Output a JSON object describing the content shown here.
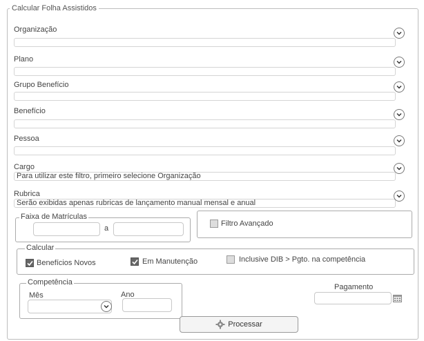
{
  "form": {
    "title": "Calcular Folha Assistidos",
    "fields": [
      {
        "label": "Organização",
        "value": ""
      },
      {
        "label": "Plano",
        "value": ""
      },
      {
        "label": "Grupo Benefício",
        "value": ""
      },
      {
        "label": "Benefício",
        "value": ""
      },
      {
        "label": "Pessoa",
        "value": ""
      },
      {
        "label": "Cargo",
        "value": "Para utilizar este filtro, primeiro selecione Organização"
      },
      {
        "label": "Rubrica",
        "value": "Serão exibidas apenas rubricas de lançamento manual mensal e anual"
      }
    ]
  },
  "faixa": {
    "title": "Faixa de Matrículas",
    "separator": "a"
  },
  "filtro": {
    "label": "Filtro Avançado",
    "checked": false
  },
  "calcular": {
    "title": "Calcular",
    "options": [
      {
        "label": "Benefícios Novos",
        "checked": true
      },
      {
        "label": "Em Manutenção",
        "checked": true
      },
      {
        "label": "Inclusive DIB > Pgto. na competência",
        "checked": false
      }
    ]
  },
  "competencia": {
    "title": "Competência",
    "mes_label": "Mês",
    "ano_label": "Ano"
  },
  "pagamento": {
    "label": "Pagamento"
  },
  "actions": {
    "processar": "Processar"
  },
  "icons": {
    "dropdown": "chevron-down-icon",
    "calendar": "calendar-icon",
    "process": "gear-icon"
  }
}
